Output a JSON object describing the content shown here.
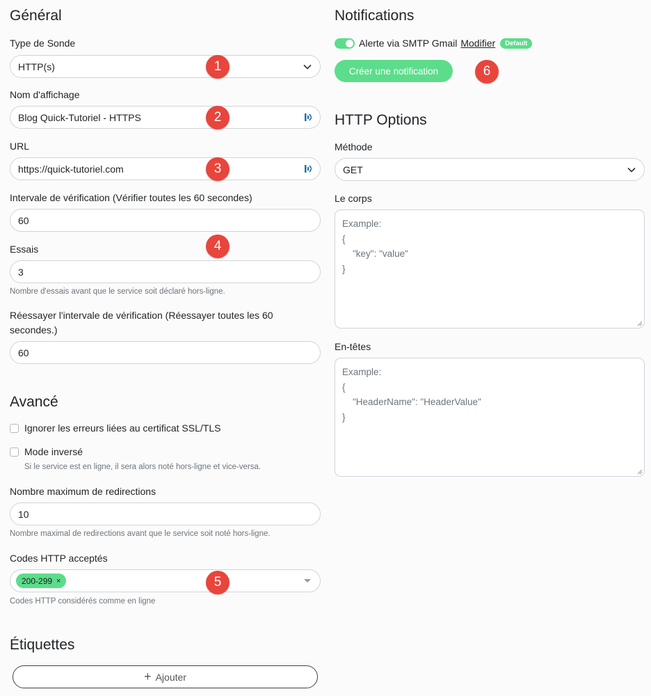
{
  "general": {
    "title": "Général",
    "monitor_type": {
      "label": "Type de Sonde",
      "value": "HTTP(s)"
    },
    "display_name": {
      "label": "Nom d'affichage",
      "value": "Blog Quick-Tutoriel - HTTPS"
    },
    "url": {
      "label": "URL",
      "value": "https://quick-tutoriel.com"
    },
    "interval": {
      "label": "Intervale de vérification (Vérifier toutes les 60 secondes)",
      "value": "60"
    },
    "retries": {
      "label": "Essais",
      "value": "3",
      "hint": "Nombre d'essais avant que le service soit déclaré hors-ligne."
    },
    "retry_interval": {
      "label_line1": "Réessayer l'intervale de vérification (Réessayer toutes les 60",
      "label_line2": "secondes.)",
      "value": "60"
    }
  },
  "advanced": {
    "title": "Avancé",
    "ignore_tls": {
      "label": "Ignorer les erreurs liées au certificat SSL/TLS",
      "checked": false
    },
    "upside_down": {
      "label": "Mode inversé",
      "checked": false,
      "hint": "Si le service est en ligne, il sera alors noté hors-ligne et vice-versa."
    },
    "max_redirects": {
      "label": "Nombre maximum de redirections",
      "value": "10",
      "hint": "Nombre maximal de redirections avant que le service soit noté hors-ligne."
    },
    "accepted_codes": {
      "label": "Codes HTTP acceptés",
      "tags": [
        "200-299"
      ],
      "remove_symbol": "×",
      "hint": "Codes HTTP considérés comme en ligne"
    }
  },
  "tags": {
    "title": "Étiquettes",
    "add_label": "Ajouter",
    "add_symbol": "+"
  },
  "notifications": {
    "title": "Notifications",
    "item_label": "Alerte via SMTP Gmail",
    "edit_link": "Modifier",
    "default_badge": "Default",
    "enabled": true,
    "create_button": "Créer une notification"
  },
  "http_options": {
    "title": "HTTP Options",
    "method": {
      "label": "Méthode",
      "value": "GET"
    },
    "body": {
      "label": "Le corps",
      "placeholder_lines": [
        "Example:",
        "{",
        "    \"key\": \"value\"",
        "}"
      ]
    },
    "headers": {
      "label": "En-têtes",
      "placeholder_lines": [
        "Example:",
        "{",
        "    \"HeaderName\": \"HeaderValue\"",
        "}"
      ]
    }
  },
  "annotations": [
    "1",
    "2",
    "3",
    "4",
    "5",
    "6"
  ],
  "colors": {
    "accent": "#5cdd8b",
    "annotation": "#e8453c"
  }
}
